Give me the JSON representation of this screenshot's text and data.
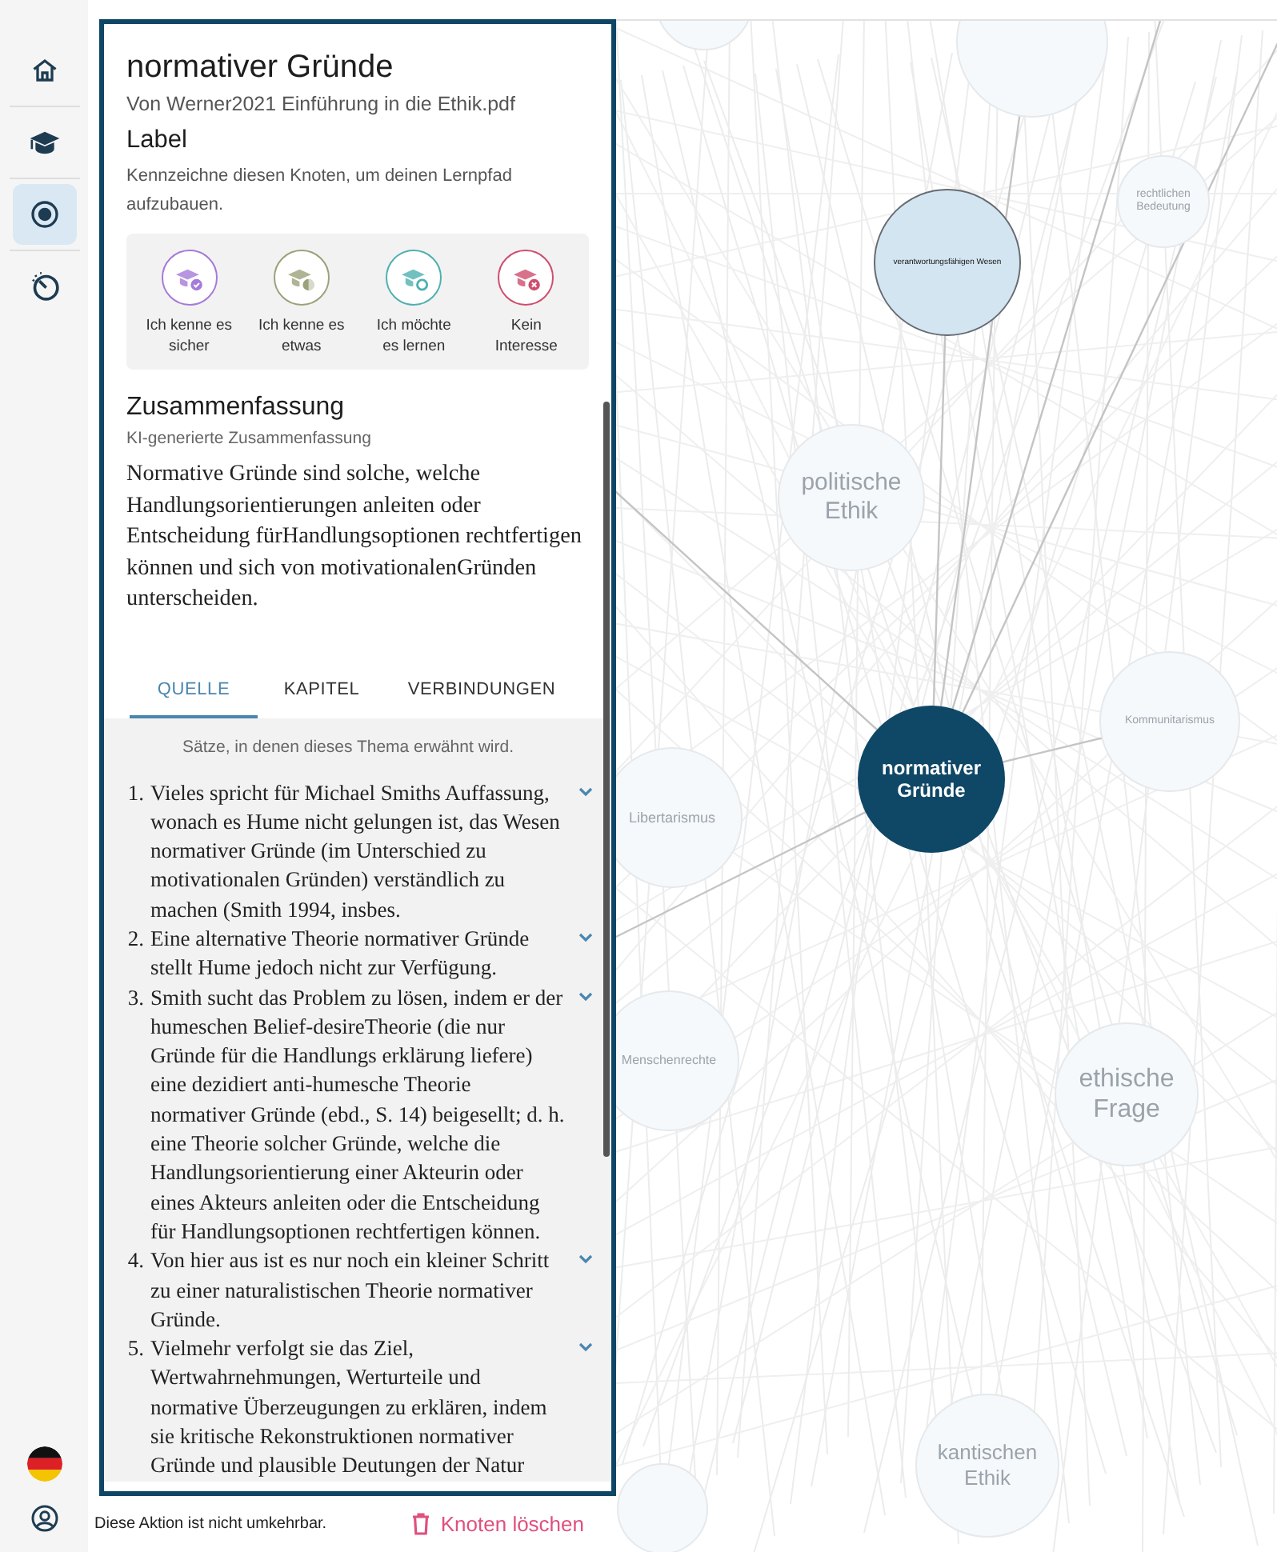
{
  "sidebar": {
    "items": [
      {
        "kind": "home",
        "selected": false
      },
      {
        "kind": "learn",
        "selected": false
      },
      {
        "kind": "node",
        "selected": true
      },
      {
        "kind": "timer",
        "selected": false
      }
    ]
  },
  "panel": {
    "title": "normativer Gründe",
    "source": "Von Werner2021 Einführung in die Ethik.pdf",
    "label_section": {
      "heading": "Label",
      "description": "Kennzeichne diesen Knoten, um deinen Lernpfad aufzubauen.",
      "options": [
        {
          "label": "Ich kenne es sicher",
          "kind": "check",
          "color": "#a57ad8",
          "selected": false
        },
        {
          "label": "Ich kenne es etwas",
          "kind": "half",
          "color": "#9aa27a",
          "selected": false
        },
        {
          "label": "Ich möchte es lernen",
          "kind": "ring",
          "color": "#4fb0b0",
          "selected": false
        },
        {
          "label": "Kein Interesse",
          "kind": "cross",
          "color": "#cf4d6e",
          "selected": false
        }
      ]
    },
    "summary": {
      "heading": "Zusammenfassung",
      "subheading": "KI-generierte Zusammenfassung",
      "text": "Normative Gründe sind solche, welche Handlungsorientierungen anleiten oder Entscheidung fürHandlungsoptionen rechtfertigen können und sich von motivationalenGründen unterscheiden."
    },
    "tabs": [
      {
        "label": "QUELLE",
        "selected": true
      },
      {
        "label": "KAPITEL",
        "selected": false
      },
      {
        "label": "VERBINDUNGEN",
        "selected": false
      }
    ],
    "sentences": {
      "description": "Sätze, in denen dieses Thema erwähnt wird.",
      "items": [
        {
          "number": "1.",
          "text": "Vieles spricht für Michael Smiths Auffassung, wonach es Hume nicht gelungen ist, das Wesen normativer Gründe (im Unterschied zu motivationalen Gründen) verständlich zu machen (Smith 1994, insbes."
        },
        {
          "number": "2.",
          "text": "Eine alternative Theorie normativer Gründe stellt Hume jedoch nicht zur Verfügung."
        },
        {
          "number": "3.",
          "text": "Smith sucht das Problem zu lösen, indem er der humeschen Belief-desireTheorie (die nur Gründe für die Handlungs erklärung liefere) eine dezidiert anti-humesche Theorie normativer Gründe (ebd., S. 14) beigesellt; d. h. eine Theorie solcher Gründe, welche die Handlungsorientierung einer Akteurin oder eines Akteurs anleiten oder die Entscheidung für Handlungsoptionen rechtfertigen können."
        },
        {
          "number": "4.",
          "text": "Von hier aus ist es nur noch ein kleiner Schritt zu einer naturalistischen Theorie normativer Gründe."
        },
        {
          "number": "5.",
          "text": "Vielmehr verfolgt sie das Ziel, Wertwahrnehmungen, Werturteile und normative Überzeugungen zu erklären, indem sie kritische Rekonstruktionen normativer Gründe und plausible Deutungen der Natur"
        }
      ]
    }
  },
  "footer": {
    "warning": "Diese Aktion ist nicht umkehrbar.",
    "delete_button": "Knoten löschen"
  },
  "graph": {
    "nodes": [
      {
        "label": "verantwortungsfähigen Wesen",
        "selected": false,
        "linked": true
      },
      {
        "label": "rechtlichen Bedeutung",
        "selected": false,
        "linked": false
      },
      {
        "label": "politische Ethik",
        "selected": false,
        "linked": false
      },
      {
        "label": "normativer Gründe",
        "selected": true,
        "linked": false
      },
      {
        "label": "Kommunitarismus",
        "selected": false,
        "linked": false
      },
      {
        "label": "Libertarismus",
        "selected": false,
        "linked": false
      },
      {
        "label": "Menschenrechte",
        "selected": false,
        "linked": false
      },
      {
        "label": "ethische Frage",
        "selected": false,
        "linked": false
      },
      {
        "label": "kantischen Ethik",
        "selected": false,
        "linked": false
      }
    ]
  }
}
